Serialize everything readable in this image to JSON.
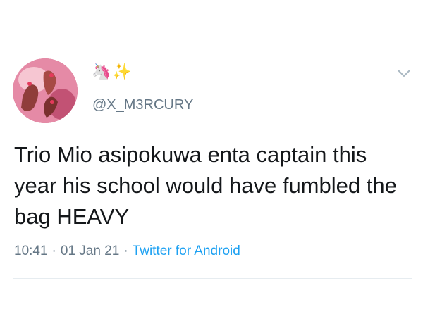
{
  "author": {
    "display_name_icons": [
      "unicorn-icon",
      "sparkles-icon"
    ],
    "display_name_emoji": {
      "unicorn": "🦄",
      "sparkles": "✨"
    },
    "handle": "@X_M3RCURY"
  },
  "tweet": {
    "text": "Trio Mio asipokuwa enta captain this year his school would have fumbled the bag HEAVY",
    "time": "10:41",
    "date": "01 Jan 21",
    "source": "Twitter for Android",
    "separator": "·"
  },
  "colors": {
    "text": "#14171a",
    "secondary": "#657786",
    "link": "#1da1f2",
    "divider": "#e6ecf0"
  }
}
